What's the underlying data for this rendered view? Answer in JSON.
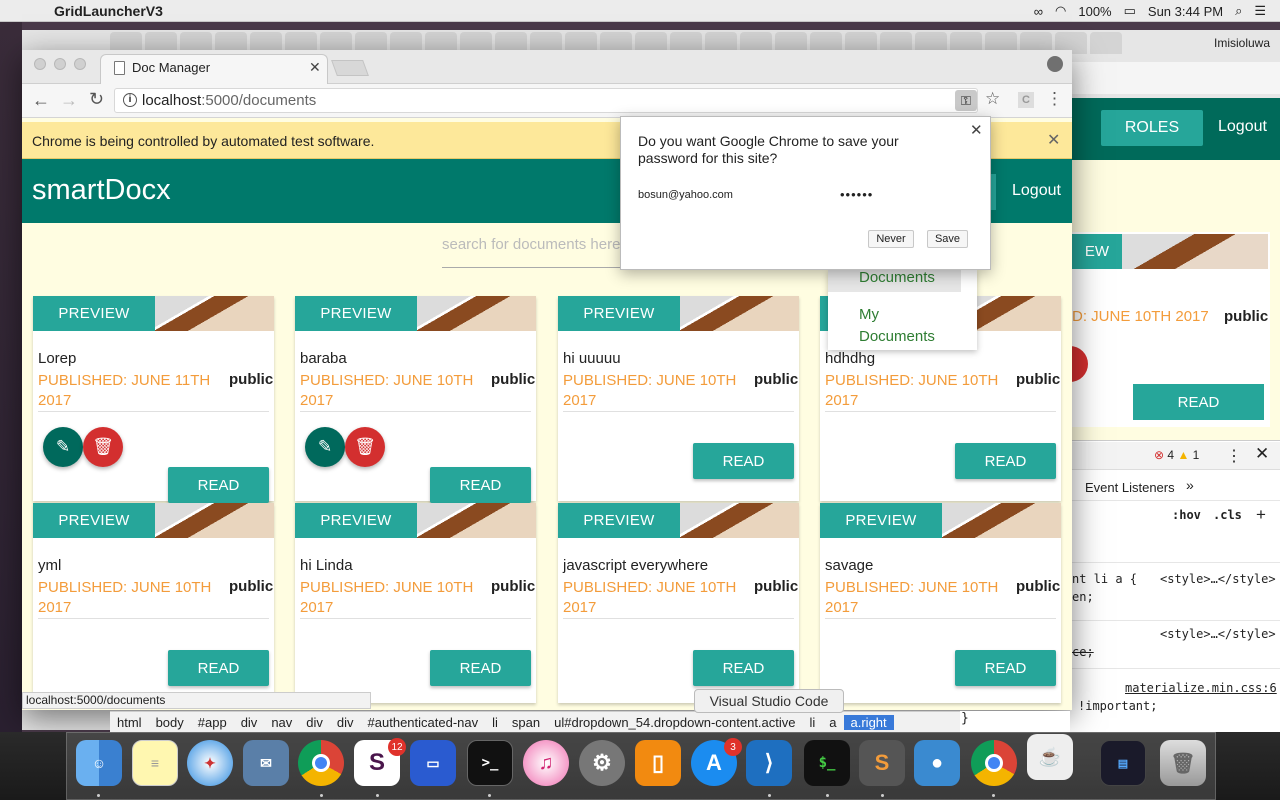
{
  "menubar": {
    "app_name": "GridLauncherV3",
    "battery": "100%",
    "clock": "Sun 3:44 PM"
  },
  "background_window": {
    "profile_name": "Imisioluwa",
    "nav_roles": "ROLES",
    "nav_logout": "Logout",
    "card_preview": "EW",
    "card_date": "D: JUNE 10TH 2017",
    "card_visibility": "public",
    "card_read": "READ"
  },
  "devtools": {
    "error_count": "4",
    "warning_count": "1",
    "tab_partial": "l",
    "tab_event_listeners": "Event Listeners",
    "hov": ":hov",
    "cls": ".cls",
    "rule1_line1": "nt li a {",
    "rule1_line2": "en;",
    "rule2_line2": "ce;",
    "source_style": "<style>…</style>",
    "source_materialize": "materialize.min.css:6",
    "important": "!important;",
    "close_brace": "}"
  },
  "browser": {
    "tab_title": "Doc Manager",
    "url_host": "localhost",
    "url_path": ":5000/documents",
    "infobar_text": "Chrome is being controlled by automated test software."
  },
  "app": {
    "brand": "smartDocx",
    "nav_logout": "Logout",
    "search_placeholder": "search for documents here."
  },
  "dropdown": {
    "item1": "Documents",
    "item2_line1": "My",
    "item2_line2": "Documents"
  },
  "password_popup": {
    "question": "Do you want Google Chrome to save your password for this site?",
    "username": "bosun@yahoo.com",
    "password_mask": "••••••",
    "never_label": "Never",
    "save_label": "Save"
  },
  "cards": [
    {
      "preview": "PREVIEW",
      "title": "Lorep",
      "date1": "PUBLISHED: JUNE 11TH",
      "date2": "2017",
      "visibility": "public",
      "read": "READ"
    },
    {
      "preview": "PREVIEW",
      "title": "baraba",
      "date1": "PUBLISHED: JUNE 10TH",
      "date2": "2017",
      "visibility": "public",
      "read": "READ"
    },
    {
      "preview": "PREVIEW",
      "title": "hi uuuuu",
      "date1": "PUBLISHED: JUNE 10TH",
      "date2": "2017",
      "visibility": "public",
      "read": "READ"
    },
    {
      "preview": "PREVIEW",
      "title": "hdhdhg",
      "date1": "PUBLISHED: JUNE 10TH",
      "date2": "2017",
      "visibility": "public",
      "read": "READ"
    },
    {
      "preview": "PREVIEW",
      "title": "yml",
      "date1": "PUBLISHED: JUNE 10TH",
      "date2": "2017",
      "visibility": "public",
      "read": "READ"
    },
    {
      "preview": "PREVIEW",
      "title": "hi Linda",
      "date1": "PUBLISHED: JUNE 10TH",
      "date2": "2017",
      "visibility": "public",
      "read": "READ"
    },
    {
      "preview": "PREVIEW",
      "title": "javascript everywhere",
      "date1": "PUBLISHED: JUNE 10TH",
      "date2": "2017",
      "visibility": "public",
      "read": "READ"
    },
    {
      "preview": "PREVIEW",
      "title": "savage",
      "date1": "PUBLISHED: JUNE 10TH",
      "date2": "2017",
      "visibility": "public",
      "read": "READ"
    }
  ],
  "status_url": "localhost:5000/documents",
  "tooltip": "Visual Studio Code",
  "breadcrumbs": [
    "html",
    "body",
    "#app",
    "div",
    "nav",
    "div",
    "div",
    "#authenticated-nav",
    "li",
    "span",
    "ul#dropdown_54.dropdown-content.active",
    "li",
    "a",
    "a.right"
  ],
  "dock": {
    "slack_badge": "12",
    "appstore_badge": "3"
  },
  "colors": {
    "nav_teal": "#00796b",
    "button_teal": "#26a69a",
    "date_orange": "#f39c3b",
    "delete_red": "#d32f2f",
    "page_background": "#fffde1"
  }
}
